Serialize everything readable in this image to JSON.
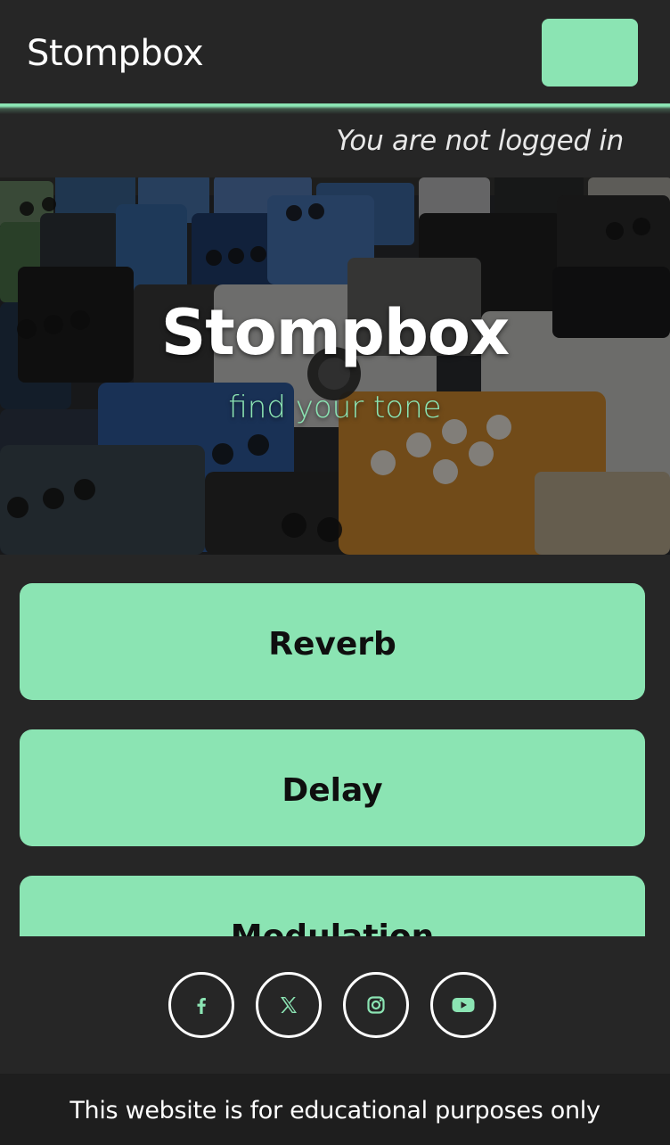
{
  "navbar": {
    "brand": "Stompbox",
    "menu_button_color": "#8be4b3"
  },
  "auth": {
    "status": "You are not logged in"
  },
  "hero": {
    "title": "Stompbox",
    "subtitle": "find your tone",
    "image": "guitar-effect-pedals-photo"
  },
  "categories": [
    {
      "label": "Reverb"
    },
    {
      "label": "Delay"
    },
    {
      "label": "Modulation"
    }
  ],
  "social": [
    {
      "name": "facebook",
      "icon": "facebook-icon"
    },
    {
      "name": "x",
      "icon": "x-icon"
    },
    {
      "name": "instagram",
      "icon": "instagram-icon"
    },
    {
      "name": "youtube",
      "icon": "youtube-icon"
    }
  ],
  "footer": {
    "text": "This website is for educational purposes only"
  },
  "colors": {
    "accent": "#8be4b3",
    "background": "#262626",
    "footer_background": "#1e1e1e"
  }
}
